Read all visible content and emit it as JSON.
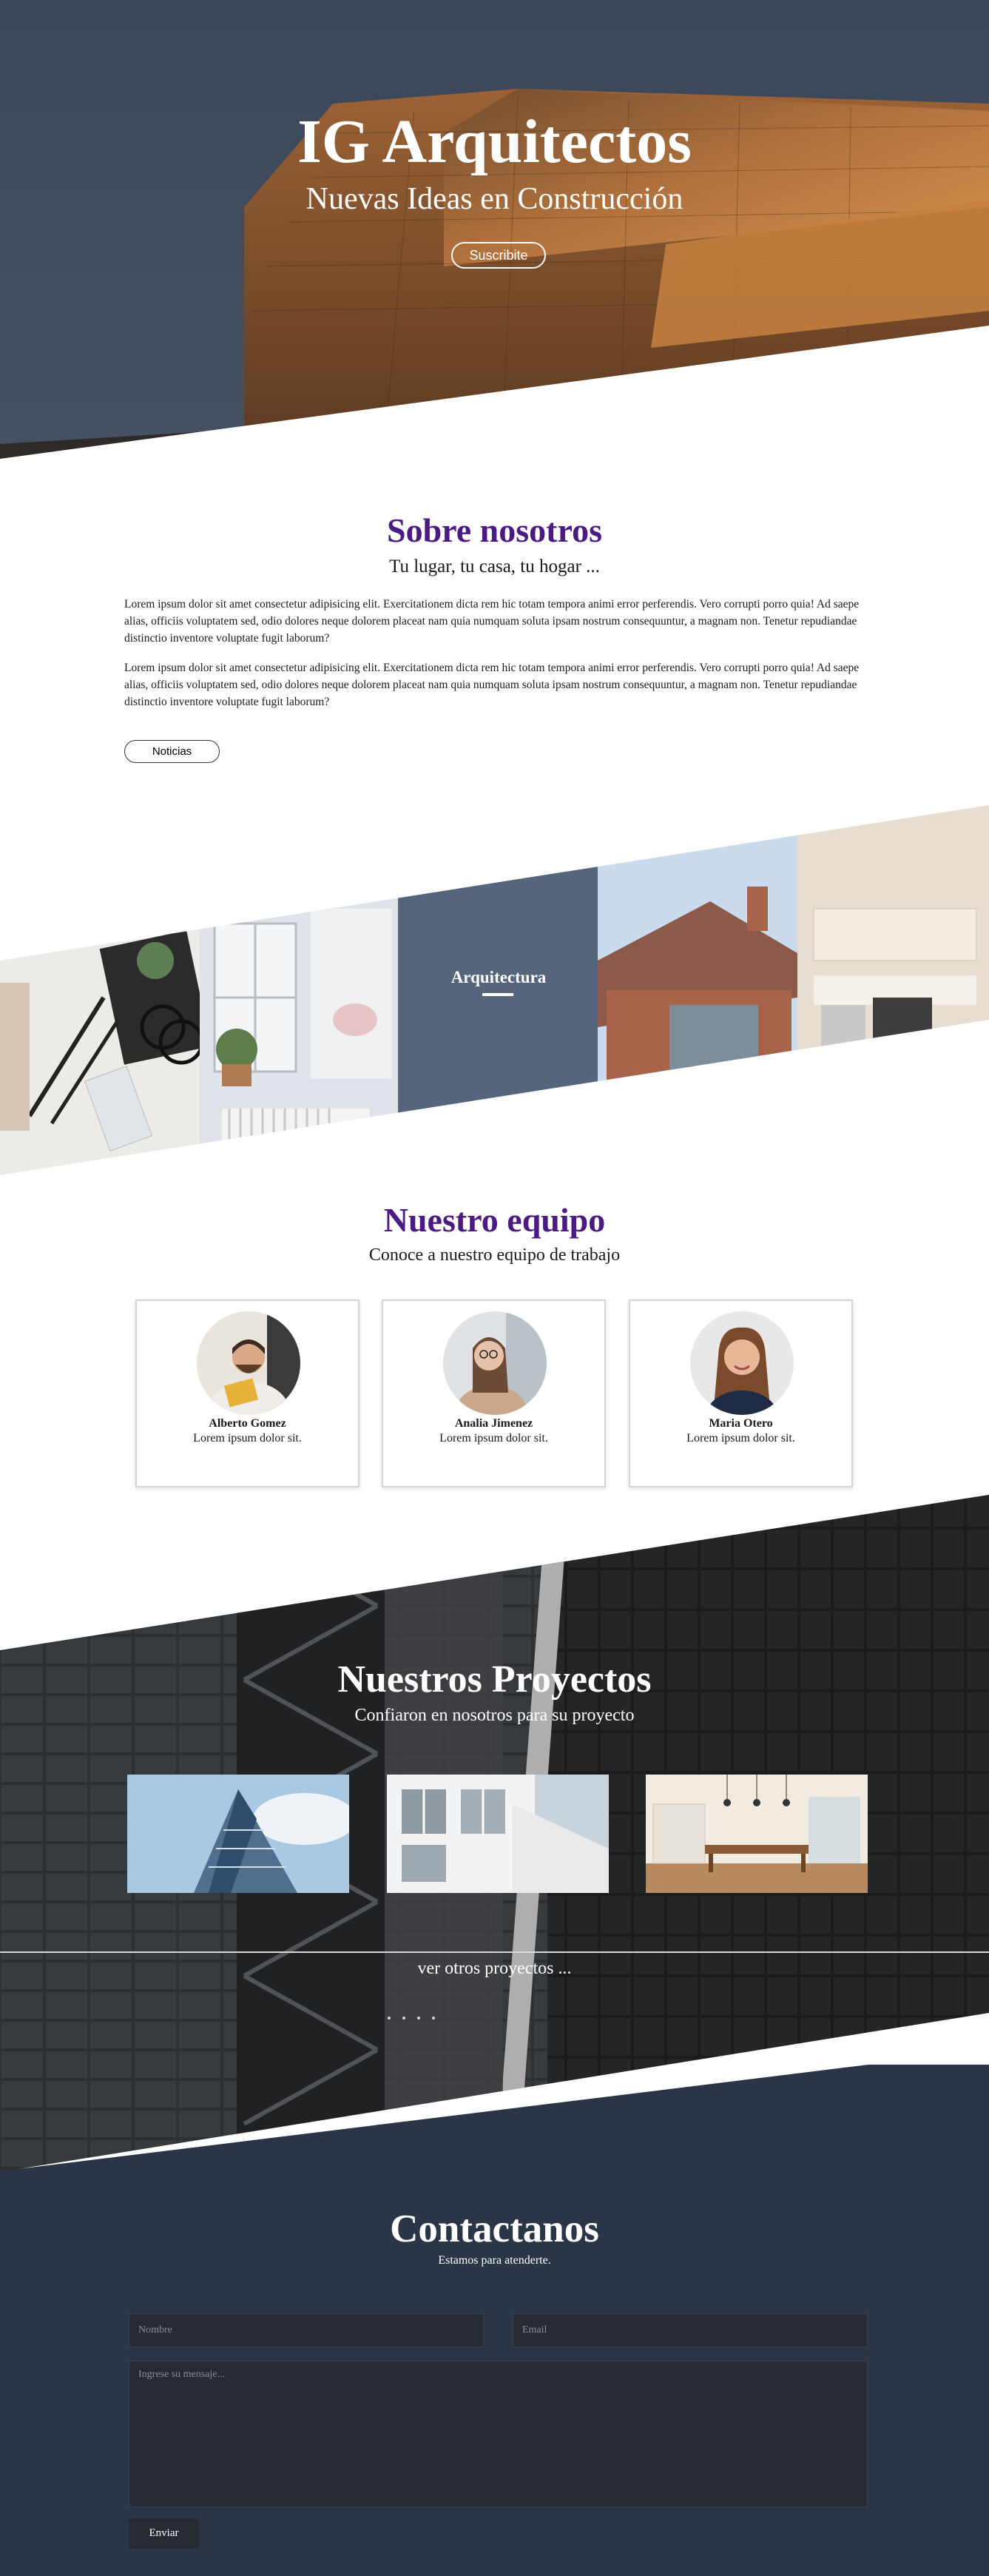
{
  "hero": {
    "title": "IG Arquitectos",
    "subtitle": "Nuevas Ideas en Construcción",
    "button_label": "Suscribite"
  },
  "about": {
    "title": "Sobre nosotros",
    "subtitle": "Tu lugar, tu casa, tu hogar ...",
    "paragraphs": [
      "Lorem ipsum dolor sit amet consectetur adipisicing elit. Exercitationem dicta rem hic totam tempora animi error perferendis. Vero corrupti porro quia! Ad saepe alias, officiis voluptatem sed, odio dolores neque dolorem placeat nam quia numquam soluta ipsam nostrum consequuntur, a magnam non. Tenetur repudiandae distinctio inventore voluptate fugit laborum?",
      "Lorem ipsum dolor sit amet consectetur adipisicing elit. Exercitationem dicta rem hic totam tempora animi error perferendis. Vero corrupti porro quia! Ad saepe alias, officiis voluptatem sed, odio dolores neque dolorem placeat nam quia numquam soluta ipsam nostrum consequuntur, a magnam non. Tenetur repudiandae distinctio inventore voluptate fugit laborum?"
    ],
    "button_label": "Noticias"
  },
  "gallery": {
    "center_label": "Arquitectura",
    "images": [
      "desk-photo",
      "window-room-photo",
      "house-photo",
      "kitchen-photo"
    ]
  },
  "team": {
    "title": "Nuestro equipo",
    "subtitle": "Conoce a nuestro equipo de trabajo",
    "members": [
      {
        "name": "Alberto Gomez",
        "desc": "Lorem ipsum dolor sit."
      },
      {
        "name": "Analia Jimenez",
        "desc": "Lorem ipsum dolor sit."
      },
      {
        "name": "Maria Otero",
        "desc": "Lorem ipsum dolor sit."
      }
    ]
  },
  "projects": {
    "title": "Nuestros Proyectos",
    "subtitle": "Confiaron en nosotros para su proyecto",
    "more_label": "ver otros proyectos ..."
  },
  "contact": {
    "title": "Contactanos",
    "subtitle": "Estamos para atenderte.",
    "name_placeholder": "Nombre",
    "email_placeholder": "Email",
    "message_placeholder": "Ingrese su mensaje...",
    "send_label": "Enviar"
  },
  "colors": {
    "accent_purple": "#4b1a85",
    "slate": "#55657c",
    "contact_bg": "#2a3547",
    "field_bg": "#262b31"
  }
}
